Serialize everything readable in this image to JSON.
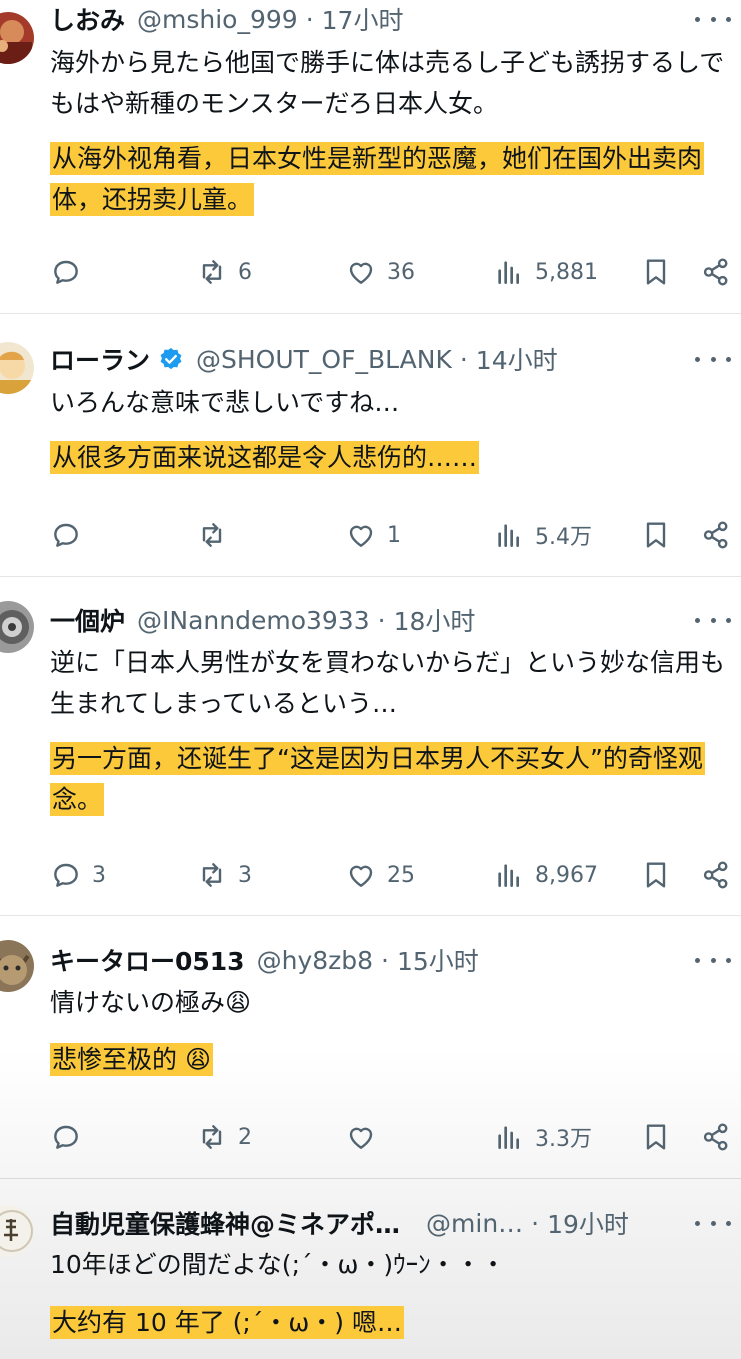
{
  "tweets": [
    {
      "name": "しおみ",
      "handle": "@mshio_999",
      "time": "17小时",
      "verified": false,
      "text": "海外から見たら他国で勝手に体は売るし子ども誘拐するしでもはや新種のモンスターだろ日本人女。",
      "translation": "从海外视角看，日本女性是新型的恶魔，她们在国外出卖肉体，还拐卖儿童。",
      "replies": "",
      "retweets": "6",
      "likes": "36",
      "views": "5,881"
    },
    {
      "name": "ローラン",
      "handle": "@SHOUT_OF_BLANK",
      "time": "14小时",
      "verified": true,
      "text": "いろんな意味で悲しいですね…",
      "translation": "从很多方面来说这都是令人悲伤的……",
      "replies": "",
      "retweets": "",
      "likes": "1",
      "views": "5.4万"
    },
    {
      "name": "一個炉",
      "handle": "@INanndemo3933",
      "time": "18小时",
      "verified": false,
      "text": "逆に「日本人男性が女を買わないからだ」という妙な信用も生まれてしまっているという…",
      "translation": "另一方面，还诞生了“这是因为日本男人不买女人”的奇怪观念。",
      "replies": "3",
      "retweets": "3",
      "likes": "25",
      "views": "8,967"
    },
    {
      "name": "キータロー0513",
      "handle": "@hy8zb8",
      "time": "15小时",
      "verified": false,
      "text": "情けないの極み😩",
      "translation": "悲惨至极的 😩",
      "replies": "",
      "retweets": "2",
      "likes": "",
      "views": "3.3万"
    },
    {
      "name": "自動児童保護蜂神@ミネアポ…",
      "handle": "@min…",
      "time": "19小时",
      "verified": false,
      "text": "10年ほどの間だよな(;´・ω・)ｳｰﾝ・・・",
      "translation": "大约有 10 年了 (;´・ω・) 嗯…"
    }
  ],
  "colors": {
    "highlight": "#fcc93b",
    "verified": "#1d9bf0",
    "muted": "#536471",
    "text": "#0f1419"
  },
  "icons": [
    "reply-icon",
    "retweet-icon",
    "like-icon",
    "views-icon",
    "bookmark-icon",
    "share-icon",
    "more-icon",
    "verified-badge-icon"
  ]
}
